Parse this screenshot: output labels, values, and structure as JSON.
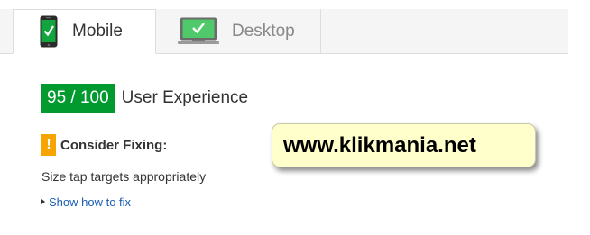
{
  "tabs": [
    {
      "label": "Mobile",
      "icon": "mobile-phone-icon",
      "active": true
    },
    {
      "label": "Desktop",
      "icon": "desktop-monitor-icon",
      "active": false
    }
  ],
  "score": {
    "badge": "95 / 100",
    "title": "User Experience",
    "badge_color": "#009a2f"
  },
  "fixing": {
    "icon_symbol": "!",
    "icon_color": "#f6a500",
    "heading": "Consider Fixing:",
    "rule": "Size tap targets appropriately",
    "link": "Show how to fix"
  },
  "watermark": {
    "text": "www.klikmania.net"
  }
}
